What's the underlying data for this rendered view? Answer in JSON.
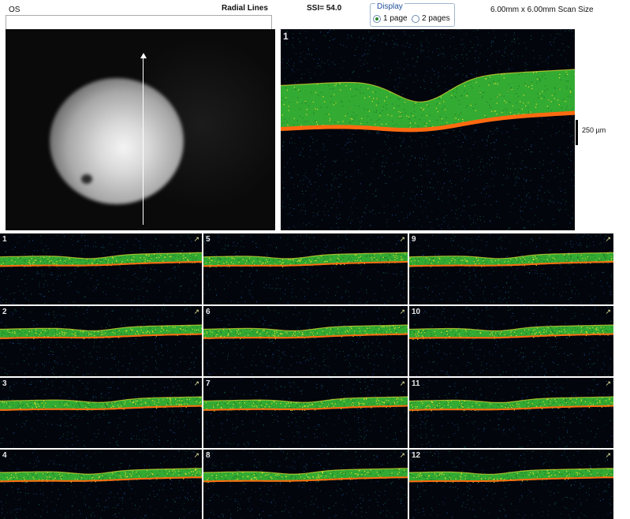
{
  "header": {
    "eye": "OS",
    "protocol": "Radial Lines",
    "ssi": "SSI= 54.0",
    "scan_size": "6.00mm x 6.00mm Scan Size"
  },
  "display": {
    "legend": "Display",
    "options": [
      {
        "label": "1 page",
        "selected": true
      },
      {
        "label": "2 pages",
        "selected": false
      }
    ]
  },
  "main_scan": {
    "number": "1"
  },
  "scale": {
    "label": "250 µm"
  },
  "thumbnails": [
    {
      "number": "1"
    },
    {
      "number": "2"
    },
    {
      "number": "3"
    },
    {
      "number": "4"
    },
    {
      "number": "5"
    },
    {
      "number": "6"
    },
    {
      "number": "7"
    },
    {
      "number": "8"
    },
    {
      "number": "9"
    },
    {
      "number": "10"
    },
    {
      "number": "11"
    },
    {
      "number": "12"
    }
  ],
  "colors": {
    "background": "#02050c",
    "retina_green": "#3cc83a",
    "retina_yellow": "#e0e030",
    "rpe_orange": "#ff6a10",
    "noise_blue": "#2a6fd0"
  }
}
